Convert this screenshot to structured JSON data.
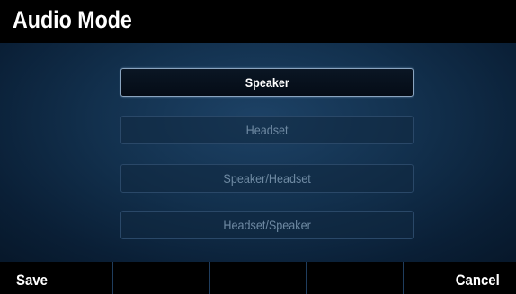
{
  "header": {
    "title": "Audio Mode"
  },
  "options": [
    {
      "label": "Speaker",
      "selected": true
    },
    {
      "label": "Headset",
      "selected": false
    },
    {
      "label": "Speaker/Headset",
      "selected": false
    },
    {
      "label": "Headset/Speaker",
      "selected": false
    }
  ],
  "softkeys": [
    {
      "label": "Save"
    },
    {
      "label": ""
    },
    {
      "label": ""
    },
    {
      "label": ""
    },
    {
      "label": "Cancel"
    }
  ],
  "colors": {
    "background": "#061423",
    "title_bar": "#000000",
    "selected_border": "#8aa4bf",
    "unselected_text": "#6f8aa3"
  }
}
